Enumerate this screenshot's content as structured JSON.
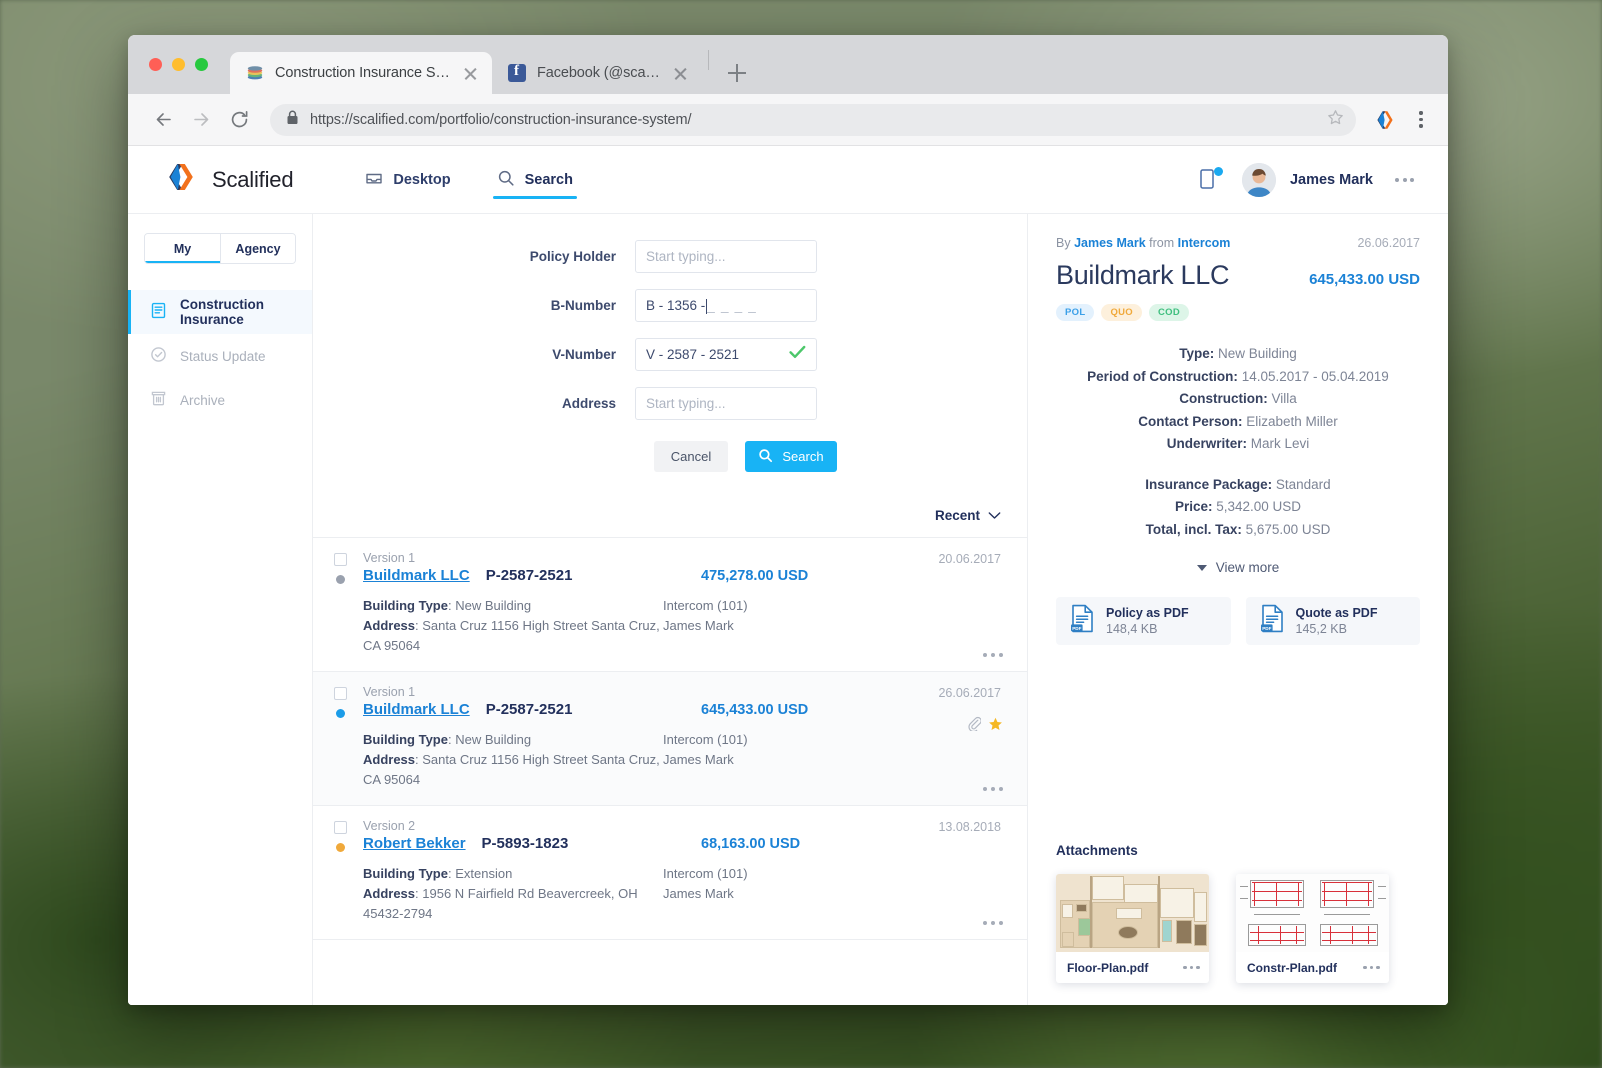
{
  "browser": {
    "tabs": [
      {
        "title": "Construction Insurance System",
        "favicon": "stack-icon",
        "active": true
      },
      {
        "title": "Facebook (@scalified)",
        "favicon": "facebook-icon",
        "active": false
      }
    ],
    "url": "https://scalified.com/portfolio/construction-insurance-system/",
    "new_tab_label": "+"
  },
  "app_header": {
    "brand": "Scalified",
    "nav": [
      {
        "label": "Desktop",
        "icon": "inbox-icon",
        "active": false
      },
      {
        "label": "Search",
        "icon": "search-icon",
        "active": true
      }
    ],
    "user": "James Mark"
  },
  "sidebar": {
    "segments": [
      {
        "label": "My",
        "active": true
      },
      {
        "label": "Agency",
        "active": false
      }
    ],
    "items": [
      {
        "label": "Construction Insurance",
        "icon": "document-list-icon",
        "active": true
      },
      {
        "label": "Status Update",
        "icon": "check-circle-icon",
        "active": false
      },
      {
        "label": "Archive",
        "icon": "archive-icon",
        "active": false
      }
    ]
  },
  "search_form": {
    "fields": [
      {
        "label": "Policy Holder",
        "value": "",
        "placeholder": "Start typing...",
        "state": "empty"
      },
      {
        "label": "B-Number",
        "value": "B - 1356 - ",
        "mask": "_ _ _ _",
        "state": "typing"
      },
      {
        "label": "V-Number",
        "value": "V - 2587 - 2521",
        "state": "valid",
        "valid_icon": "check-icon"
      },
      {
        "label": "Address",
        "value": "",
        "placeholder": "Start typing...",
        "state": "empty"
      }
    ],
    "cancel_label": "Cancel",
    "search_label": "Search",
    "search_icon": "search-icon"
  },
  "results_toolbar": {
    "sort_label": "Recent",
    "sort_icon": "chevron-down-icon"
  },
  "results": [
    {
      "version": "Version 1",
      "name": "Buildmark LLC",
      "policy_number": "P-2587-2521",
      "amount": "475,278.00 USD",
      "date": "20.06.2017",
      "building_type_label": "Building Type",
      "building_type": "New Building",
      "address_label": "Address",
      "address": "Santa Cruz 1156 High Street Santa Cruz, CA 95064",
      "source": "Intercom (101)",
      "owner": "James Mark",
      "status_color": "#9aa1ae",
      "selected": false,
      "has_attachment": false,
      "starred": false
    },
    {
      "version": "Version 1",
      "name": "Buildmark LLC",
      "policy_number": "P-2587-2521",
      "amount": "645,433.00 USD",
      "date": "26.06.2017",
      "building_type_label": "Building Type",
      "building_type": "New Building",
      "address_label": "Address",
      "address": "Santa Cruz 1156 High Street Santa Cruz, CA 95064",
      "source": "Intercom (101)",
      "owner": "James Mark",
      "status_color": "#1b9ce8",
      "selected": true,
      "has_attachment": true,
      "starred": true
    },
    {
      "version": "Version 2",
      "name": "Robert Bekker",
      "policy_number": "P-5893-1823",
      "amount": "68,163.00 USD",
      "date": "13.08.2018",
      "building_type_label": "Building Type",
      "building_type": "Extension",
      "address_label": "Address",
      "address": "1956 N Fairfield Rd Beavercreek, OH 45432-2794",
      "source": "Intercom (101)",
      "owner": "James Mark",
      "status_color": "#f0a93b",
      "selected": false,
      "has_attachment": false,
      "starred": false
    }
  ],
  "detail": {
    "by_prefix": "By",
    "author": "James Mark",
    "from_word": "from",
    "source": "Intercom",
    "date": "26.06.2017",
    "title": "Buildmark LLC",
    "amount": "645,433.00 USD",
    "badges": [
      {
        "label": "POL",
        "bg": "#e3f1fd",
        "fg": "#3a9fe8"
      },
      {
        "label": "QUO",
        "bg": "#fdf0dc",
        "fg": "#f0a93b"
      },
      {
        "label": "COD",
        "bg": "#ddf5e8",
        "fg": "#3fbf7f"
      }
    ],
    "specs": [
      {
        "label": "Type:",
        "value": "New Building"
      },
      {
        "label": "Period of Construction:",
        "value": "14.05.2017 - 05.04.2019"
      },
      {
        "label": "Construction:",
        "value": "Villa"
      },
      {
        "label": "Contact Person:",
        "value": "Elizabeth Miller"
      },
      {
        "label": "Underwriter:",
        "value": "Mark Levi"
      }
    ],
    "specs2": [
      {
        "label": "Insurance Package:",
        "value": "Standard"
      },
      {
        "label": "Price:",
        "value": "5,342.00 USD"
      },
      {
        "label": "Total, incl. Tax:",
        "value": "5,675.00 USD"
      }
    ],
    "view_more_label": "View more",
    "documents": [
      {
        "name": "Policy as PDF",
        "size": "148,4 KB",
        "icon": "pdf-icon"
      },
      {
        "name": "Quote as PDF",
        "size": "145,2 KB",
        "icon": "pdf-icon"
      }
    ],
    "attachments_title": "Attachments",
    "attachments": [
      {
        "name": "Floor-Plan.pdf",
        "thumb": "floor-plan-thumbnail"
      },
      {
        "name": "Constr-Plan.pdf",
        "thumb": "construction-plan-thumbnail"
      }
    ]
  },
  "colors": {
    "accent": "#18b3f5",
    "link": "#1b82d6",
    "navy": "#22305c",
    "muted": "#9aa1ae"
  }
}
